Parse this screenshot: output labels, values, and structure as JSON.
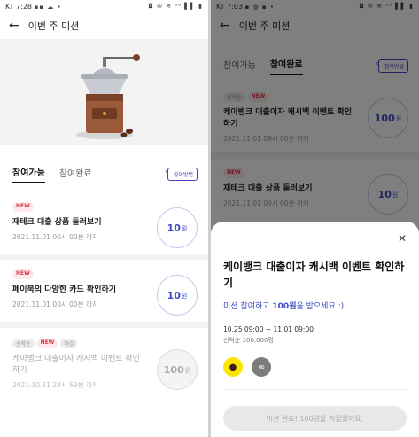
{
  "left": {
    "status": {
      "time": "KT 7:28",
      "icons": "▪▪ ☁ •",
      "right": "◘ ✇ ≋ ⁶⁶ ▌▌ ▮"
    },
    "title": "이번 주 미션",
    "tabs": [
      "참여가능",
      "참여완료"
    ],
    "howto": "참여방법",
    "items": [
      {
        "badges": [
          "NEW"
        ],
        "title": "재테크 대출 상품 둘러보기",
        "date": "2021.11.01 00시 00분 까지",
        "reward": "10",
        "unit": "원"
      },
      {
        "badges": [
          "NEW"
        ],
        "title": "페이북의 다양한 카드 확인하기",
        "date": "2021.11.01 00시 00분 까지",
        "reward": "10",
        "unit": "원"
      },
      {
        "badges": [
          "선착순",
          "NEW",
          "마감"
        ],
        "title": "케이뱅크 대출이자 캐시백 이벤트 확인하기",
        "date": "2021.10.31 23시 59분 까지",
        "reward": "100",
        "unit": "원"
      }
    ]
  },
  "right": {
    "status": {
      "time": "KT 7:03",
      "icons": "▪ ◍ ▪ •",
      "right": "◘ ✇ ≋ ⁶⁶ ▌▌ ▮"
    },
    "title": "이번 주 미션",
    "tabs": [
      "참여가능",
      "참여완료"
    ],
    "howto": "참여방법",
    "items": [
      {
        "badges": [
          "선착순",
          "NEW"
        ],
        "title": "케이뱅크 대출이자 캐시백 이벤트 확인하기",
        "date": "2021.11.01 09시 00분 까지",
        "reward": "100",
        "unit": "원"
      },
      {
        "badges": [
          "NEW"
        ],
        "title": "재테크 대출 상품 둘러보기",
        "date": "2021.11.01 09시 00분 까지",
        "reward": "10",
        "unit": "원"
      }
    ],
    "sheet": {
      "close": "✕",
      "title": "케이뱅크 대출이자 캐시백 이벤트 확인하기",
      "sub_prefix": "미션 참여하고 ",
      "sub_amount": "100원",
      "sub_suffix": "을 받으세요 :)",
      "period": "10.25 09:00 ~ 11.01 09:00",
      "condition": "선착순 100,000명",
      "complete_button": "미션 완료! 100원을 적립했어요."
    }
  }
}
